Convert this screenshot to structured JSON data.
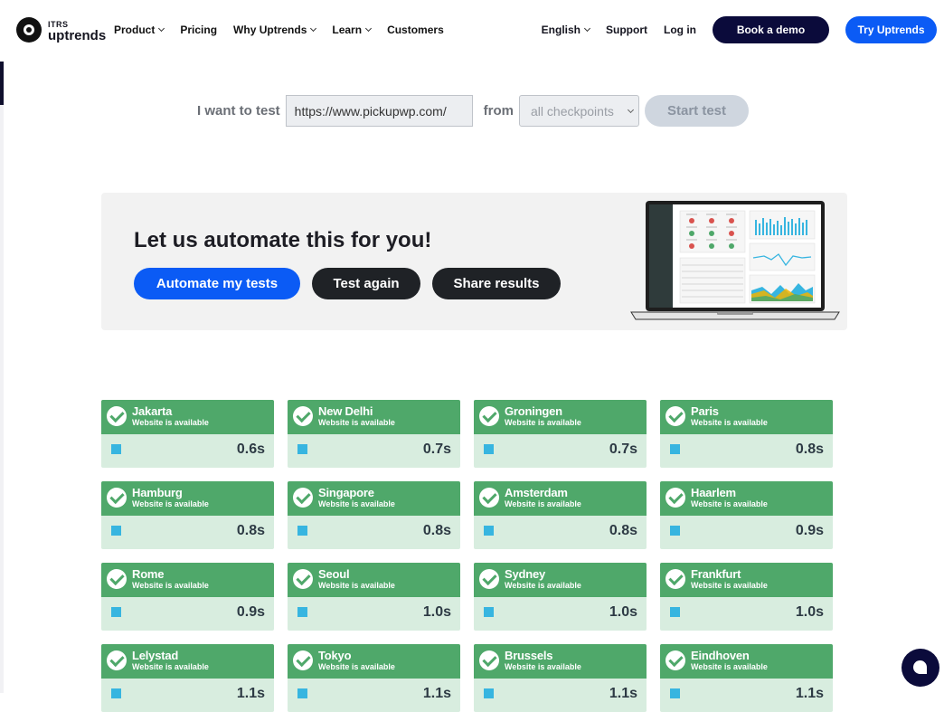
{
  "nav": {
    "logo_top": "ITRS",
    "logo_bottom": "uptrends",
    "items": [
      {
        "label": "Product",
        "dropdown": true
      },
      {
        "label": "Pricing",
        "dropdown": false
      },
      {
        "label": "Why Uptrends",
        "dropdown": true
      },
      {
        "label": "Learn",
        "dropdown": true
      },
      {
        "label": "Customers",
        "dropdown": false
      }
    ],
    "language": "English",
    "support": "Support",
    "login": "Log in",
    "book_demo": "Book a demo",
    "try": "Try Uptrends"
  },
  "form": {
    "label": "I want to test",
    "url_value": "https://www.pickupwp.com/",
    "from_label": "from",
    "checkpoint_value": "all checkpoints",
    "start_button": "Start test"
  },
  "promo": {
    "title": "Let us automate this for you!",
    "automate_button": "Automate my tests",
    "test_again_button": "Test again",
    "share_button": "Share results"
  },
  "results": [
    {
      "city": "Jakarta",
      "status": "Website is available",
      "time": "0.6s"
    },
    {
      "city": "New Delhi",
      "status": "Website is available",
      "time": "0.7s"
    },
    {
      "city": "Groningen",
      "status": "Website is available",
      "time": "0.7s"
    },
    {
      "city": "Paris",
      "status": "Website is available",
      "time": "0.8s"
    },
    {
      "city": "Hamburg",
      "status": "Website is available",
      "time": "0.8s"
    },
    {
      "city": "Singapore",
      "status": "Website is available",
      "time": "0.8s"
    },
    {
      "city": "Amsterdam",
      "status": "Website is available",
      "time": "0.8s"
    },
    {
      "city": "Haarlem",
      "status": "Website is available",
      "time": "0.9s"
    },
    {
      "city": "Rome",
      "status": "Website is available",
      "time": "0.9s"
    },
    {
      "city": "Seoul",
      "status": "Website is available",
      "time": "1.0s"
    },
    {
      "city": "Sydney",
      "status": "Website is available",
      "time": "1.0s"
    },
    {
      "city": "Frankfurt",
      "status": "Website is available",
      "time": "1.0s"
    },
    {
      "city": "Lelystad",
      "status": "Website is available",
      "time": "1.1s"
    },
    {
      "city": "Tokyo",
      "status": "Website is available",
      "time": "1.1s"
    },
    {
      "city": "Brussels",
      "status": "Website is available",
      "time": "1.1s"
    },
    {
      "city": "Eindhoven",
      "status": "Website is available",
      "time": "1.1s"
    }
  ],
  "colors": {
    "available_green": "#4fa86a",
    "card_body": "#d8eddf",
    "brand_blue": "#0b5bf5",
    "brand_navy": "#0b0b3b",
    "metric_square": "#37b5e0"
  },
  "icons": {
    "logo": "itrs-logo-icon",
    "card_status": "check-circle-icon",
    "chat": "chat-bubble-icon"
  }
}
